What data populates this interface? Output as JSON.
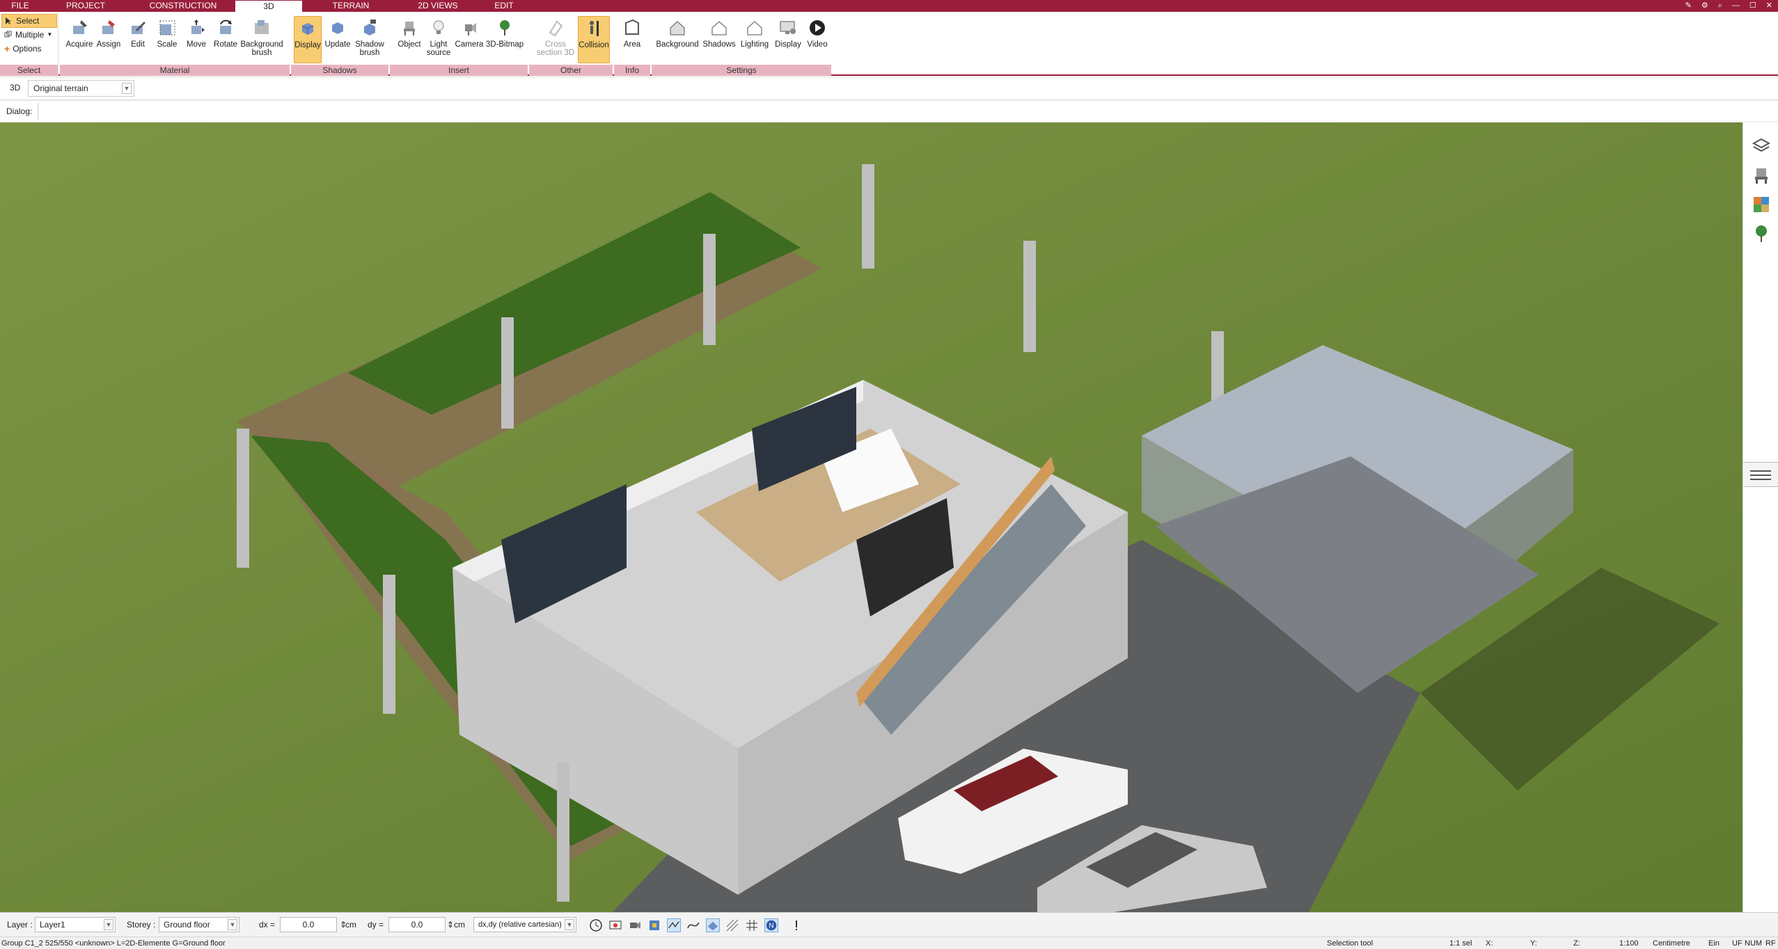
{
  "tabs": [
    "FILE",
    "PROJECT",
    "CONSTRUCTION",
    "3D",
    "TERRAIN",
    "2D VIEWS",
    "EDIT"
  ],
  "active_tab": "3D",
  "ribbon": {
    "select": {
      "items": [
        "Select",
        "Multiple",
        "Options"
      ],
      "group": "Select"
    },
    "material": {
      "group": "Material",
      "buttons": [
        "Acquire",
        "Assign",
        "Edit",
        "Scale",
        "Move",
        "Rotate",
        "Background brush"
      ]
    },
    "shadows": {
      "group": "Shadows",
      "buttons": [
        "Display",
        "Update",
        "Shadow brush"
      ]
    },
    "insert": {
      "group": "Insert",
      "buttons": [
        "Object",
        "Light source",
        "Camera",
        "3D-Bitmap"
      ]
    },
    "other": {
      "group": "Other",
      "buttons": [
        "Cross section 3D",
        "Collision"
      ]
    },
    "info": {
      "group": "Info",
      "buttons": [
        "Area"
      ]
    },
    "settings": {
      "group": "Settings",
      "buttons": [
        "Background",
        "Shadows",
        "Lighting",
        "Display",
        "Video"
      ]
    }
  },
  "viewbar": {
    "mode": "3D",
    "terrain": "Original terrain"
  },
  "dialogbar": {
    "label": "Dialog:"
  },
  "bottombar": {
    "layer_label": "Layer :",
    "layer_value": "Layer1",
    "storey_label": "Storey :",
    "storey_value": "Ground floor",
    "dx_label": "dx =",
    "dx_value": "0.0",
    "dy_label": "dy =",
    "dy_value": "0.0",
    "unit": "cm",
    "coord_mode": "dx,dy (relative cartesian)"
  },
  "status": {
    "group_info": "Group C1_2 525/550 <unknown> L=2D-Elemente G=Ground floor",
    "tool": "Selection tool",
    "scale_sel": "1:1 sel",
    "x": "X:",
    "y": "Y:",
    "z": "Z:",
    "scale": "1:100",
    "units": "Centimetre",
    "ein": "Ein",
    "uf": "UF",
    "num": "NUM",
    "rf": "RF"
  },
  "colors": {
    "accent": "#9a1e3b",
    "group_label_bg": "#e8b3c0",
    "active_btn": "#f8cd72",
    "grass": "#6f8a3b"
  }
}
